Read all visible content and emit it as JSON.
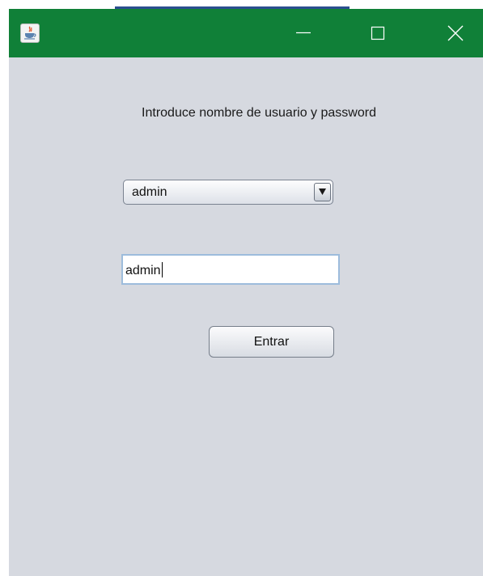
{
  "window": {
    "title": "",
    "titlebar_color": "#108038",
    "background_color": "#d6d9e0",
    "icons": {
      "app": "java-coffee-icon",
      "minimize": "minimize-icon",
      "maximize": "maximize-icon",
      "close": "close-icon"
    }
  },
  "form": {
    "prompt": "Introduce nombre de usuario y password",
    "user_select": {
      "selected": "admin"
    },
    "password_field": {
      "value": "admin"
    },
    "submit_label": "Entrar"
  }
}
